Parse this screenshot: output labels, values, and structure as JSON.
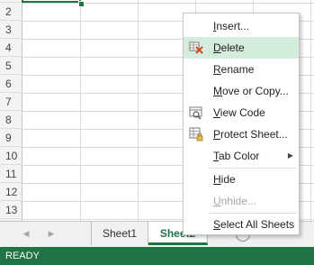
{
  "grid": {
    "row_numbers": [
      "2",
      "3",
      "4",
      "5",
      "6",
      "7",
      "8",
      "9",
      "10",
      "11",
      "12",
      "13"
    ]
  },
  "context_menu": {
    "items": [
      {
        "label": "Insert...",
        "mnemonic": "I"
      },
      {
        "label": "Delete",
        "mnemonic": "D",
        "icon": "delete-sheet-icon",
        "highlighted": true
      },
      {
        "label": "Rename",
        "mnemonic": "R"
      },
      {
        "label": "Move or Copy...",
        "mnemonic": "M"
      },
      {
        "label": "View Code",
        "mnemonic": "V",
        "icon": "view-code-icon"
      },
      {
        "label": "Protect Sheet...",
        "mnemonic": "P",
        "icon": "protect-sheet-icon"
      },
      {
        "label": "Tab Color",
        "mnemonic": "T",
        "has_submenu": true
      },
      {
        "label": "Hide",
        "mnemonic": "H"
      },
      {
        "label": "Unhide...",
        "mnemonic": "U",
        "disabled": true
      },
      {
        "label": "Select All Sheets",
        "mnemonic": "S"
      }
    ]
  },
  "sheet_tabs": {
    "tabs": [
      {
        "label": "Sheet1",
        "active": false
      },
      {
        "label": "Sheet2",
        "active": true
      }
    ],
    "add_sheet_symbol": "+"
  },
  "status_bar": {
    "status": "READY"
  },
  "colors": {
    "accent": "#217346",
    "menu_highlight": "#d3ecdc"
  }
}
